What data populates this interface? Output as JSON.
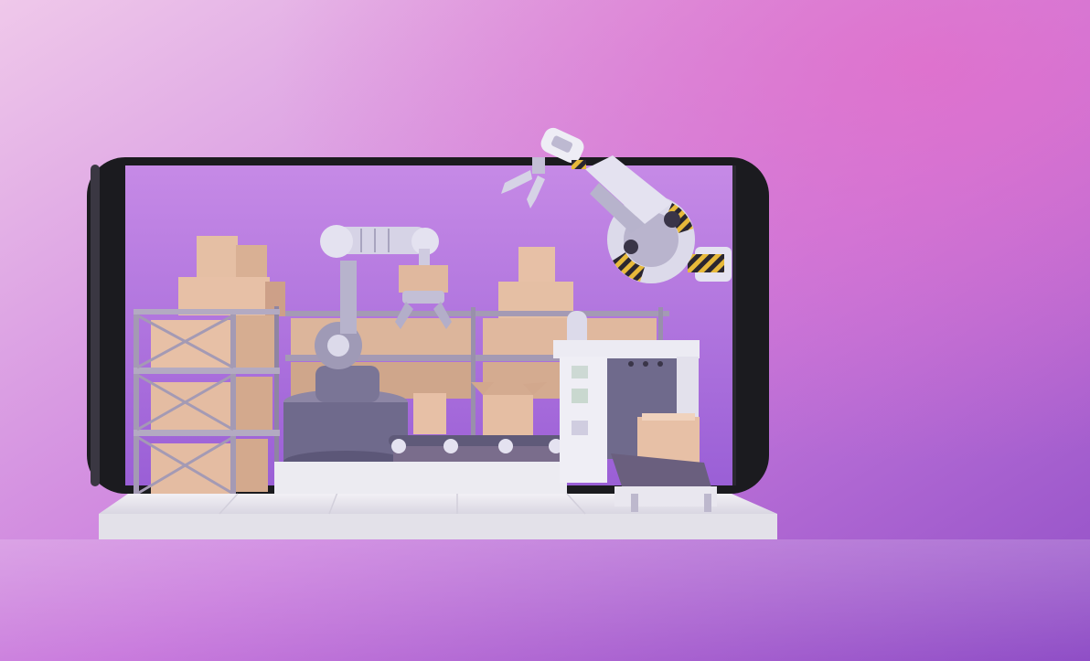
{
  "scene": {
    "description_icon": "warehouse-automation-illustration",
    "colors": {
      "bg_top_left": "#efc8ea",
      "bg_top_right": "#d873d0",
      "bg_bottom": "#9a52c9",
      "bg_mid": "#c67ce0",
      "phone_bezel": "#1b1b1f",
      "screen_bg": "#b36fe0",
      "box": "#e7c0a6",
      "box_shade": "#c99e86",
      "shelf": "#a49ab4",
      "floor": "#e9e7ee",
      "robot_light": "#dcdaea",
      "robot_mid": "#9f9ab6",
      "robot_dark": "#5f5a79",
      "hazard_yellow": "#e7b93a",
      "conveyor": "#7a6d8c"
    }
  }
}
